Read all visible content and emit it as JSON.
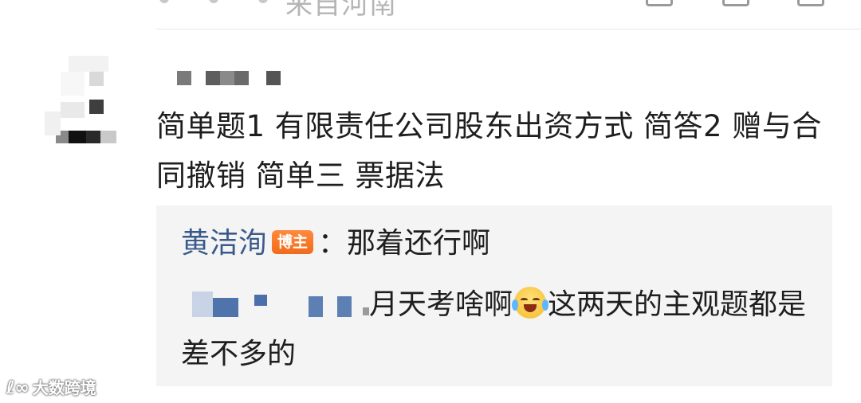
{
  "top_row": {
    "partial_text": "来自河南"
  },
  "comment": {
    "text": "简单题1 有限责任公司股东出资方式  简答2 赠与合同撤销 简单三 票据法"
  },
  "reply": {
    "author": "黄洁洵",
    "badge": "博主",
    "author_text": "：那着还行啊",
    "quoted_partial": "月天考啥啊",
    "emoji": "crying-laughing-emoji",
    "quoted_rest": "这两天的主观题都是差不多的"
  },
  "watermark": {
    "logo": "ℓ∞",
    "text": "大数跨境"
  },
  "colors": {
    "author_link": "#3b5a8c",
    "badge_bg": "#f26a1b",
    "reply_bg": "#f4f4f4",
    "text": "#1e1e1e"
  }
}
